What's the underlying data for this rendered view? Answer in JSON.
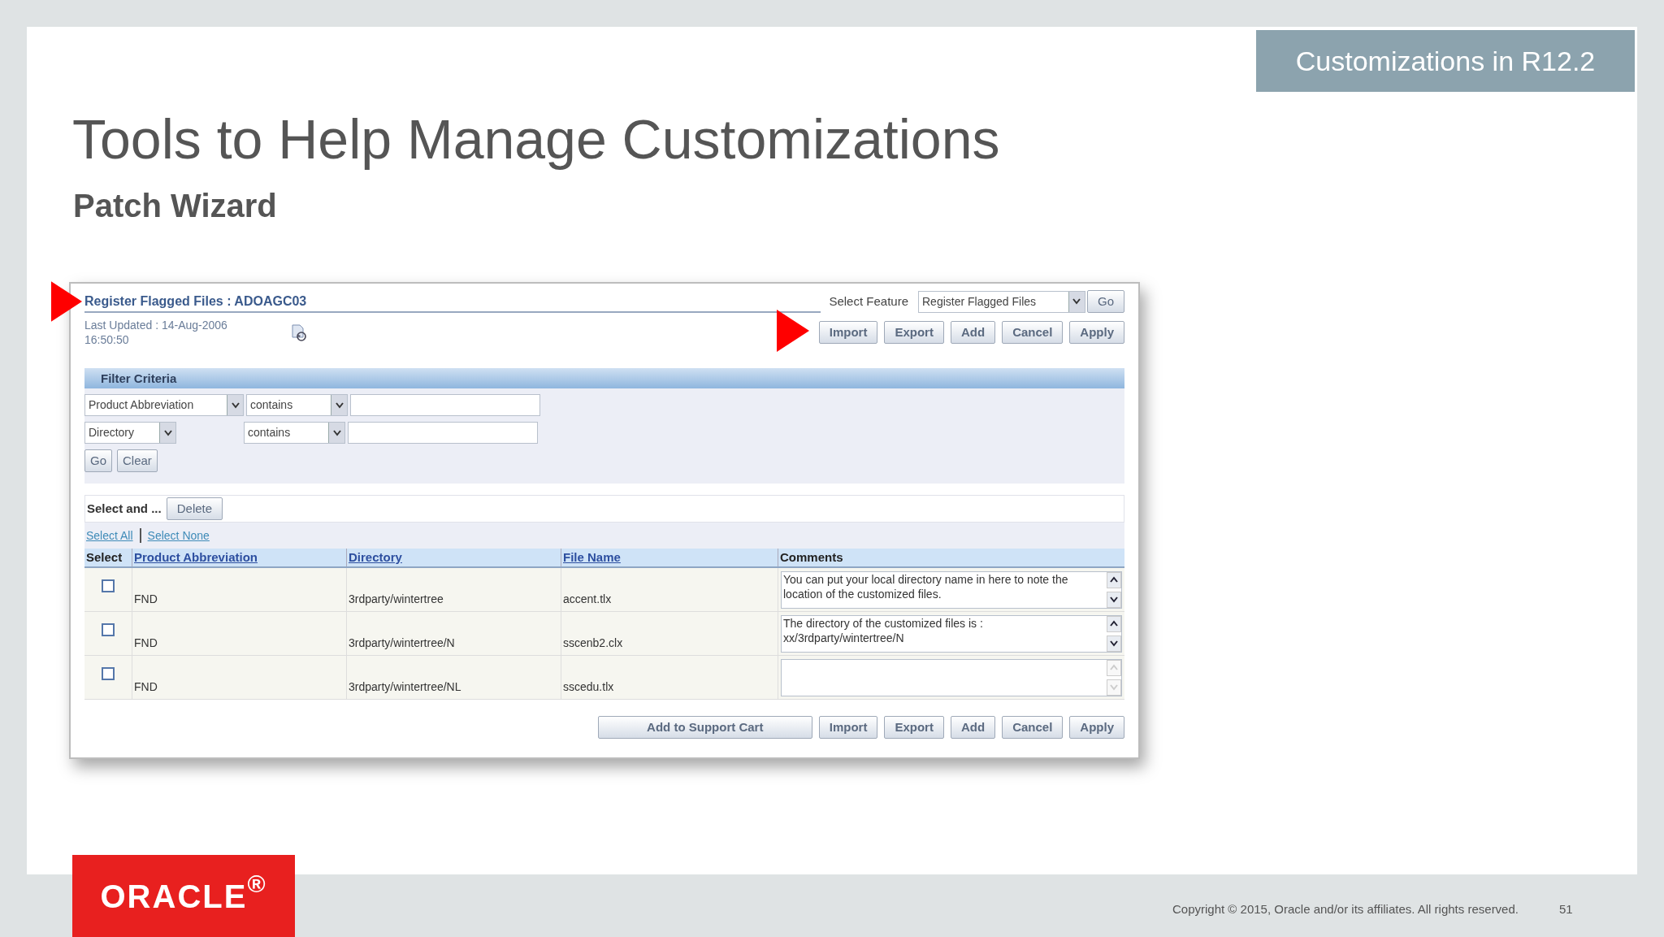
{
  "slide": {
    "tag": "Customizations in R12.2",
    "title": "Tools to Help Manage Customizations",
    "subtitle": "Patch Wizard"
  },
  "screenshot": {
    "page_title": "Register Flagged Files : ADOAGC03",
    "last_updated": "Last Updated : 14-Aug-2006\n16:50:50",
    "select_feature": {
      "label": "Select Feature",
      "value": "Register Flagged Files",
      "go": "Go"
    },
    "top_buttons": [
      "Import",
      "Export",
      "Add",
      "Cancel",
      "Apply"
    ],
    "filter": {
      "title": "Filter Criteria",
      "rows": [
        {
          "field": "Product Abbreviation",
          "operator": "contains"
        },
        {
          "field": "Directory",
          "operator": "contains"
        }
      ],
      "buttons": [
        "Go",
        "Clear"
      ]
    },
    "select_and": {
      "label": "Select and ...",
      "button": "Delete"
    },
    "select_links": [
      "Select All",
      "Select None"
    ],
    "table": {
      "columns": [
        "Select",
        "Product Abbreviation",
        "Directory",
        "File Name",
        "Comments"
      ],
      "rows": [
        {
          "checked": false,
          "product": "FND",
          "directory": "3rdparty/wintertree",
          "file": "accent.tlx",
          "comment": "You can put your local directory name in here to note the location of the customized files."
        },
        {
          "checked": false,
          "product": "FND",
          "directory": "3rdparty/wintertree/N",
          "file": "sscenb2.clx",
          "comment": "The directory of the customized files is :\nxx/3rdparty/wintertree/N"
        },
        {
          "checked": false,
          "product": "FND",
          "directory": "3rdparty/wintertree/NL",
          "file": "sscedu.tlx"
        }
      ]
    },
    "bottom_buttons": [
      "Add to Support Cart",
      "Import",
      "Export",
      "Add",
      "Cancel",
      "Apply"
    ]
  },
  "footer": {
    "logo": "ORACLE$^{®}$",
    "copyright": "Copyright © 2015, Oracle and/or its affiliates. All rights reserved.",
    "page_number": "51"
  }
}
